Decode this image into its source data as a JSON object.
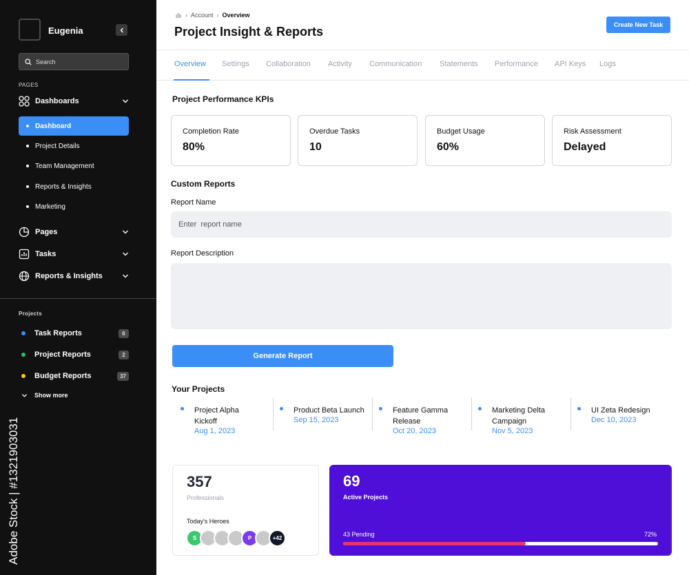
{
  "sidebar": {
    "brand_name": "Eugenia",
    "search_placeholder": "Search",
    "pages_label": "PAGES",
    "dashboards_label": "Dashboards",
    "sub_items": [
      {
        "label": "Dashboard",
        "active": true
      },
      {
        "label": "Project Details"
      },
      {
        "label": "Team Management"
      },
      {
        "label": "Reports & Insights"
      },
      {
        "label": "Marketing"
      }
    ],
    "groups": [
      {
        "label": "Pages"
      },
      {
        "label": "Tasks"
      },
      {
        "label": "Reports & Insights"
      }
    ],
    "projects_label": "Projects",
    "projects": [
      {
        "label": "Task Reports",
        "count": "6",
        "color": "#3b8ef5"
      },
      {
        "label": "Project Reports",
        "count": "2",
        "color": "#22c55e"
      },
      {
        "label": "Budget Reports",
        "count": "37",
        "color": "#facc15"
      }
    ],
    "show_more": "Show more",
    "watermark": "Adobe Stock | #1321903031"
  },
  "header": {
    "breadcrumb": [
      "Account",
      "Overview"
    ],
    "title": "Project Insight & Reports",
    "create_button": "Create New Task"
  },
  "tabs": [
    "Overview",
    "Settings",
    "Collaboration",
    "Activity",
    "Communication",
    "Statements",
    "Performance",
    "API Keys",
    "Logs"
  ],
  "active_tab": "Overview",
  "kpis": {
    "title": "Project Performance KPIs",
    "items": [
      {
        "label": "Completion Rate",
        "value": "80%"
      },
      {
        "label": "Overdue Tasks",
        "value": "10"
      },
      {
        "label": "Budget Usage",
        "value": "60%"
      },
      {
        "label": "Risk Assessment",
        "value": "Delayed"
      }
    ]
  },
  "custom_reports": {
    "title": "Custom Reports",
    "name_label": "Report Name",
    "name_placeholder": "Enter  report name",
    "description_label": "Report Description",
    "generate_button": "Generate Report"
  },
  "projects": {
    "title": "Your Projects",
    "items": [
      {
        "name": "Project Alpha Kickoff",
        "date": "Aug 1, 2023"
      },
      {
        "name": "Product Beta Launch",
        "date": "Sep 15, 2023"
      },
      {
        "name": "Feature Gamma Release",
        "date": "Oct 20, 2023"
      },
      {
        "name": "Marketing Delta Campaign",
        "date": "Nov 5, 2023"
      },
      {
        "name": "UI Zeta Redesign",
        "date": "Dec 10, 2023"
      }
    ]
  },
  "stats": {
    "professionals_count": "357",
    "professionals_label": "Professionals",
    "heroes_label": "Today's Heroes",
    "avatars": [
      {
        "initial": "S",
        "color": "#3cc76f"
      },
      {
        "initial": "",
        "color": "#c9c9c9"
      },
      {
        "initial": "",
        "color": "#c9c9c9"
      },
      {
        "initial": "",
        "color": "#c9c9c9"
      },
      {
        "initial": "P",
        "color": "#7c3aed"
      },
      {
        "initial": "",
        "color": "#c9c9c9"
      },
      {
        "initial": "+42",
        "color": "#111827"
      }
    ],
    "active_count": "69",
    "active_label": "Active Projects",
    "pending_label": "43 Pending",
    "percent_label": "72%",
    "progress_fraction": 0.58
  },
  "colors": {
    "accent": "#3b8ef5",
    "purple": "#4f0fd9",
    "progress": "#e8336f"
  }
}
